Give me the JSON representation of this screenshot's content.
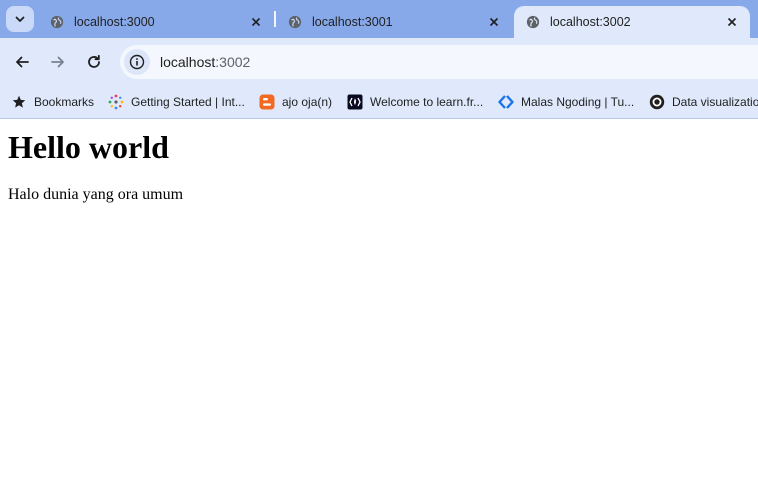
{
  "tabs": [
    {
      "title": "localhost:3000",
      "active": false
    },
    {
      "title": "localhost:3001",
      "active": false
    },
    {
      "title": "localhost:3002",
      "active": true
    }
  ],
  "address_bar": {
    "host": "localhost",
    "port": ":3002"
  },
  "bookmarks_bar": {
    "items": [
      {
        "label": "Bookmarks",
        "icon": "star-icon"
      },
      {
        "label": "Getting Started | Int...",
        "icon": "sparkle-icon"
      },
      {
        "label": "ajo oja(n)",
        "icon": "blogger-icon"
      },
      {
        "label": "Welcome to learn.fr...",
        "icon": "freecodecamp-icon"
      },
      {
        "label": "Malas Ngoding | Tu...",
        "icon": "diamond-arrows-icon"
      },
      {
        "label": "Data visualization",
        "icon": "observable-icon"
      }
    ]
  },
  "page": {
    "heading": "Hello world",
    "paragraph": "Halo dunia yang ora umum"
  },
  "colors": {
    "tabstrip": "#87a9e9",
    "toolbar": "#dfe9fb",
    "blogger_orange": "#f26a21",
    "diamond_blue": "#1a73e8"
  }
}
